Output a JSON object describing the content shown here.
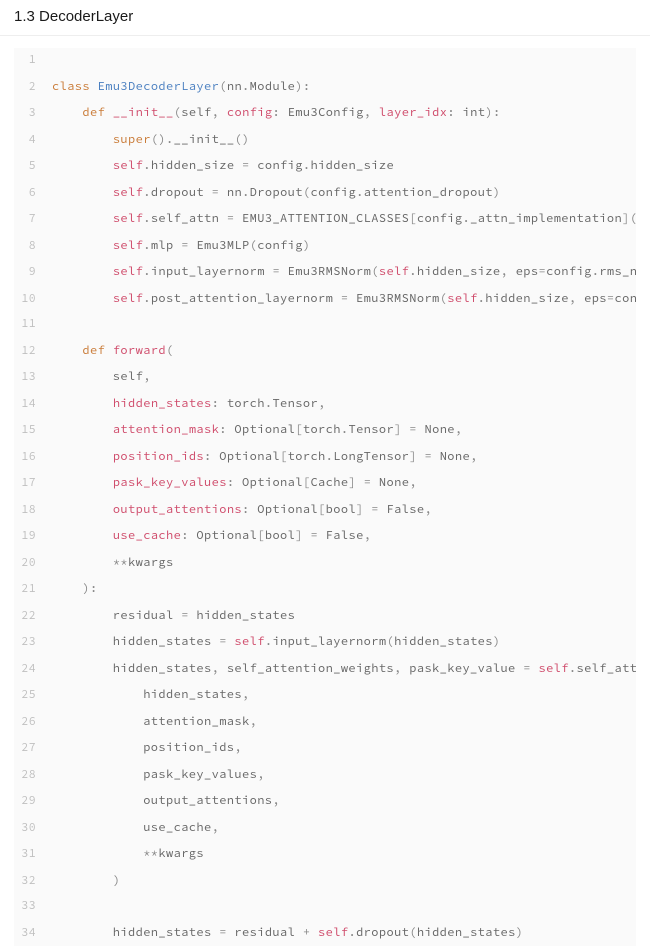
{
  "heading": "1.3 DecoderLayer",
  "code": {
    "lines": [
      {
        "n": 1,
        "html": ""
      },
      {
        "n": 2,
        "html": "<span class='kw'>class</span> <span class='cls'>Emu3DecoderLayer</span><span class='pun'>(</span>nn<span class='pun'>.</span>Module<span class='pun'>):</span>"
      },
      {
        "n": 3,
        "html": "    <span class='kw'>def</span> <span class='fn'>__init__</span><span class='pun'>(</span>self<span class='pun'>,</span> <span class='param'>config</span><span class='pun'>:</span> Emu3Config<span class='pun'>,</span> <span class='param'>layer_idx</span><span class='pun'>:</span> int<span class='pun'>):</span>"
      },
      {
        "n": 4,
        "html": "        <span class='kw'>super</span><span class='pun'>().</span>__init__<span class='pun'>()</span>"
      },
      {
        "n": 5,
        "html": "        <span class='slf'>self</span><span class='pun'>.</span>hidden_size <span class='pun'>=</span> config<span class='pun'>.</span>hidden_size"
      },
      {
        "n": 6,
        "html": "        <span class='slf'>self</span><span class='pun'>.</span>dropout <span class='pun'>=</span> nn<span class='pun'>.</span>Dropout<span class='pun'>(</span>config<span class='pun'>.</span>attention_dropout<span class='pun'>)</span>"
      },
      {
        "n": 7,
        "html": "        <span class='slf'>self</span><span class='pun'>.</span>self_attn <span class='pun'>=</span> EMU3_ATTENTION_CLASSES<span class='pun'>[</span>config<span class='pun'>.</span>_attn_implementation<span class='pun'>]</span><span class='pun'>(</span>"
      },
      {
        "n": 8,
        "html": "        <span class='slf'>self</span><span class='pun'>.</span>mlp <span class='pun'>=</span> Emu3MLP<span class='pun'>(</span>config<span class='pun'>)</span>"
      },
      {
        "n": 9,
        "html": "        <span class='slf'>self</span><span class='pun'>.</span>input_layernorm <span class='pun'>=</span> Emu3RMSNorm<span class='pun'>(</span><span class='slf'>self</span><span class='pun'>.</span>hidden_size<span class='pun'>,</span> eps<span class='pun'>=</span>config<span class='pun'>.</span>rms_n"
      },
      {
        "n": 10,
        "html": "        <span class='slf'>self</span><span class='pun'>.</span>post_attention_layernorm <span class='pun'>=</span> Emu3RMSNorm<span class='pun'>(</span><span class='slf'>self</span><span class='pun'>.</span>hidden_size<span class='pun'>,</span> eps<span class='pun'>=</span>con"
      },
      {
        "n": 11,
        "html": ""
      },
      {
        "n": 12,
        "html": "    <span class='kw'>def</span> <span class='fn'>forward</span><span class='pun'>(</span>"
      },
      {
        "n": 13,
        "html": "        self<span class='pun'>,</span>"
      },
      {
        "n": 14,
        "html": "        <span class='param'>hidden_states</span><span class='pun'>:</span> torch<span class='pun'>.</span>Tensor<span class='pun'>,</span>"
      },
      {
        "n": 15,
        "html": "        <span class='param'>attention_mask</span><span class='pun'>:</span> Optional<span class='pun'>[</span>torch<span class='pun'>.</span>Tensor<span class='pun'>]</span> <span class='pun'>=</span> None<span class='pun'>,</span>"
      },
      {
        "n": 16,
        "html": "        <span class='param'>position_ids</span><span class='pun'>:</span> Optional<span class='pun'>[</span>torch<span class='pun'>.</span>LongTensor<span class='pun'>]</span> <span class='pun'>=</span> None<span class='pun'>,</span>"
      },
      {
        "n": 17,
        "html": "        <span class='param'>pask_key_values</span><span class='pun'>:</span> Optional<span class='pun'>[</span>Cache<span class='pun'>]</span> <span class='pun'>=</span> None<span class='pun'>,</span>"
      },
      {
        "n": 18,
        "html": "        <span class='param'>output_attentions</span><span class='pun'>:</span> Optional<span class='pun'>[</span>bool<span class='pun'>]</span> <span class='pun'>=</span> False<span class='pun'>,</span>"
      },
      {
        "n": 19,
        "html": "        <span class='param'>use_cache</span><span class='pun'>:</span> Optional<span class='pun'>[</span>bool<span class='pun'>]</span> <span class='pun'>=</span> False<span class='pun'>,</span>"
      },
      {
        "n": 20,
        "html": "        <span class='pun'>**</span>kwargs"
      },
      {
        "n": 21,
        "html": "    <span class='pun'>):</span>"
      },
      {
        "n": 22,
        "html": "        residual <span class='pun'>=</span> hidden_states"
      },
      {
        "n": 23,
        "html": "        hidden_states <span class='pun'>=</span> <span class='slf'>self</span><span class='pun'>.</span>input_layernorm<span class='pun'>(</span>hidden_states<span class='pun'>)</span>"
      },
      {
        "n": 24,
        "html": "        hidden_states<span class='pun'>,</span> self_attention_weights<span class='pun'>,</span> pask_key_value <span class='pun'>=</span> <span class='slf'>self</span><span class='pun'>.</span>self_att"
      },
      {
        "n": 25,
        "html": "            hidden_states<span class='pun'>,</span>"
      },
      {
        "n": 26,
        "html": "            attention_mask<span class='pun'>,</span>"
      },
      {
        "n": 27,
        "html": "            position_ids<span class='pun'>,</span>"
      },
      {
        "n": 28,
        "html": "            pask_key_values<span class='pun'>,</span>"
      },
      {
        "n": 29,
        "html": "            output_attentions<span class='pun'>,</span>"
      },
      {
        "n": 30,
        "html": "            use_cache<span class='pun'>,</span>"
      },
      {
        "n": 31,
        "html": "            <span class='pun'>**</span>kwargs"
      },
      {
        "n": 32,
        "html": "        <span class='pun'>)</span>"
      },
      {
        "n": 33,
        "html": ""
      },
      {
        "n": 34,
        "html": "        hidden_states <span class='pun'>=</span> residual <span class='pun'>+</span> <span class='slf'>self</span><span class='pun'>.</span>dropout<span class='pun'>(</span>hidden_states<span class='pun'>)</span>"
      }
    ]
  }
}
